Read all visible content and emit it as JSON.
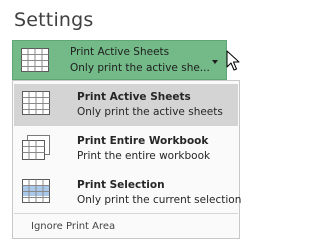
{
  "section": {
    "title": "Settings"
  },
  "dropdown": {
    "selected_title": "Print Active Sheets",
    "selected_subtitle": "Only print the active she...",
    "icon": "active-sheets-icon",
    "accent_color": "#73ba88"
  },
  "menu": {
    "options": [
      {
        "title": "Print Active Sheets",
        "subtitle": "Only print the active sheets",
        "icon": "active-sheets-icon",
        "selected": true
      },
      {
        "title": "Print Entire Workbook",
        "subtitle": "Print the entire workbook",
        "icon": "entire-workbook-icon",
        "selected": false
      },
      {
        "title": "Print Selection",
        "subtitle": "Only print the current selection",
        "icon": "selection-icon",
        "selected": false
      }
    ],
    "ignore_print_area": "Ignore Print Area"
  }
}
